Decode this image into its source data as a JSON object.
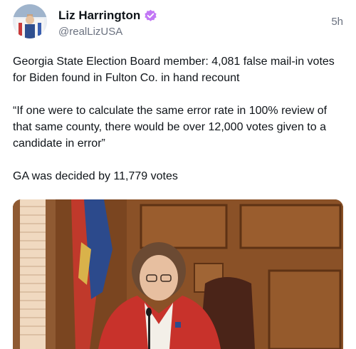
{
  "post": {
    "author": {
      "display_name": "Liz Harrington",
      "handle": "@realLizUSA",
      "verified": true,
      "verified_color": "#b070f0"
    },
    "timestamp": "5h",
    "paragraphs": [
      "Georgia State Election Board member: 4,081 false mail-in votes for Biden found in Fulton Co. in hand recount",
      "“If one were to calculate the same error rate in 100% review of that same county, there would be over 12,000 votes given to a candidate in error”",
      "GA was decided by 11,779 votes"
    ],
    "icons": {
      "verified": "verified-badge-icon"
    }
  }
}
